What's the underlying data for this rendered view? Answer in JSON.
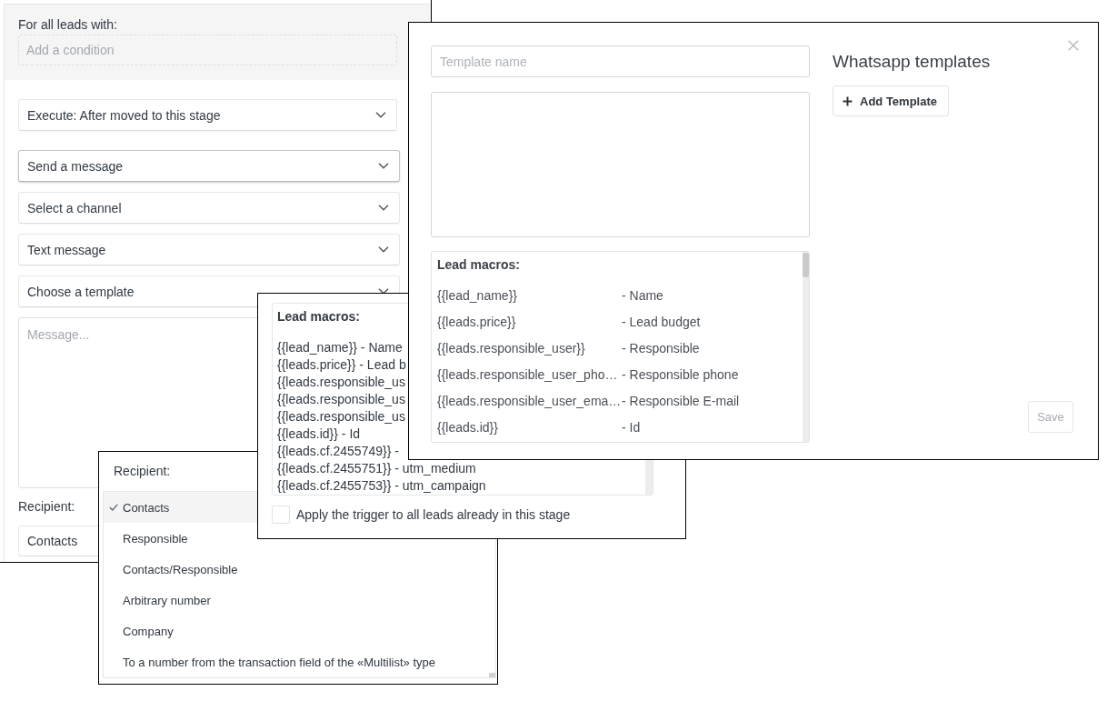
{
  "trigger_panel": {
    "condition_label": "For all leads with:",
    "condition_field": {
      "placeholder": "Add a condition"
    },
    "execute_select": {
      "value": "Execute: After moved to this stage"
    },
    "action_selects": [
      {
        "value": "Send a message",
        "focused": true
      },
      {
        "value": "Select a channel",
        "focused": false
      },
      {
        "value": "Text message",
        "focused": false
      },
      {
        "value": "Choose a template",
        "focused": false
      }
    ],
    "message_field": {
      "placeholder": "Message..."
    },
    "recipient_label": "Recipient:",
    "recipient_select": {
      "value": "Contacts"
    }
  },
  "recipient_dropdown": {
    "title": "Recipient:",
    "options": [
      {
        "label": "Contacts",
        "selected": true
      },
      {
        "label": "Responsible",
        "selected": false
      },
      {
        "label": "Contacts/Responsible",
        "selected": false
      },
      {
        "label": "Arbitrary number",
        "selected": false
      },
      {
        "label": "Company",
        "selected": false
      },
      {
        "label": "To a number from the transaction field of the «Multilist» type",
        "selected": false
      }
    ]
  },
  "macros_panel": {
    "title": "Lead macros:",
    "lines": [
      "{{lead_name}} - Name",
      "{{leads.price}} - Lead b",
      "{{leads.responsible_us",
      "{{leads.responsible_us",
      "{{leads.responsible_us",
      "{{leads.id}} - Id",
      "{{leads.cf.2455749}} -",
      "{{leads.cf.2455751}} - utm_medium",
      "{{leads.cf.2455753}} - utm_campaign"
    ],
    "apply_checkbox": {
      "label": "Apply the trigger to all leads already in this stage",
      "checked": false
    }
  },
  "templates_dialog": {
    "name_field": {
      "placeholder": "Template name"
    },
    "macros": {
      "title": "Lead macros:",
      "rows": [
        {
          "code": "{{lead_name}}",
          "description": "- Name"
        },
        {
          "code": "{{leads.price}}",
          "description": "- Lead budget"
        },
        {
          "code": "{{leads.responsible_user}}",
          "description": "- Responsible"
        },
        {
          "code": "{{leads.responsible_user_pho…",
          "description": "- Responsible phone"
        },
        {
          "code": "{{leads.responsible_user_ema…",
          "description": "- Responsible E-mail"
        },
        {
          "code": "{{leads.id}}",
          "description": "- Id"
        }
      ]
    },
    "title": "Whatsapp templates",
    "add_button": "Add Template",
    "save_button": {
      "label": "Save",
      "disabled": true
    }
  }
}
